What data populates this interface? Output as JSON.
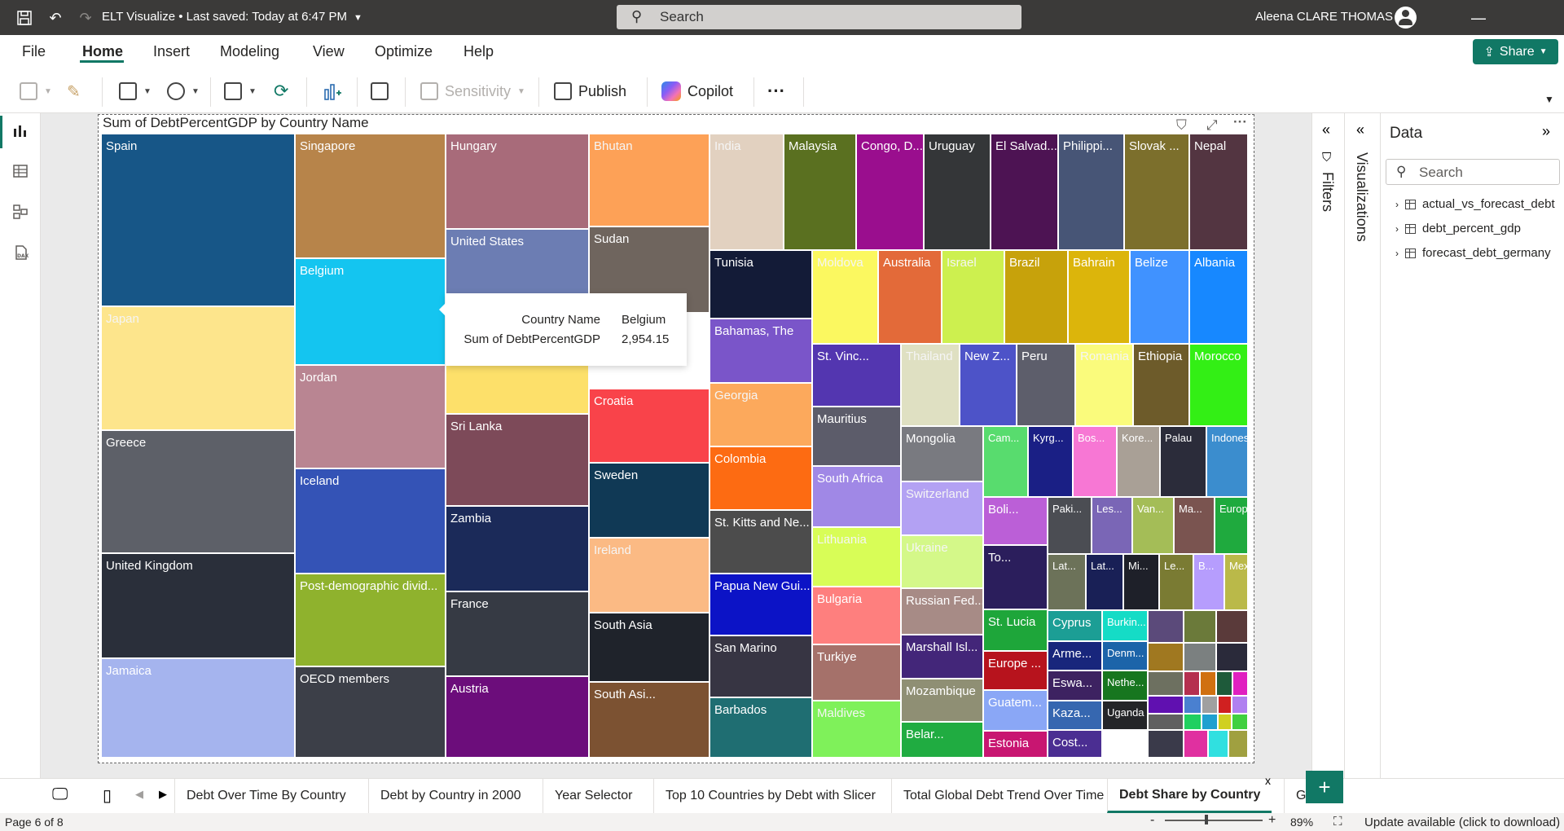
{
  "window": {
    "title": "ELT Visualize • Last saved: Today at 6:47 PM",
    "search_placeholder": "Search",
    "user_name": "Aleena CLARE THOMAS"
  },
  "menu": {
    "items": [
      "File",
      "Home",
      "Insert",
      "Modeling",
      "View",
      "Optimize",
      "Help"
    ],
    "active": "Home",
    "share_label": "Share"
  },
  "toolbar": {
    "sensitivity_label": "Sensitivity",
    "publish_label": "Publish",
    "copilot_label": "Copilot",
    "more_label": "···"
  },
  "visual": {
    "title": "Sum of DebtPercentGDP by Country Name",
    "tooltip": {
      "field_label": "Country Name",
      "field_value": "Belgium",
      "measure_label": "Sum of DebtPercentGDP",
      "measure_value": "2,954.15"
    }
  },
  "chart_data": {
    "type": "treemap",
    "title": "Sum of DebtPercentGDP by Country Name",
    "items": [
      {
        "label": "Spain",
        "color": "#175687"
      },
      {
        "label": "Japan",
        "color": "#fde58c"
      },
      {
        "label": "Greece",
        "color": "#5d6068"
      },
      {
        "label": "United Kingdom",
        "color": "#2a2f3a"
      },
      {
        "label": "Jamaica",
        "color": "#a5b4ee"
      },
      {
        "label": "Singapore",
        "color": "#b7844a"
      },
      {
        "label": "Belgium",
        "color": "#14c5f0"
      },
      {
        "label": "Jordan",
        "color": "#b98592"
      },
      {
        "label": "Iceland",
        "color": "#3453b6"
      },
      {
        "label": "Post-demographic divid...",
        "color": "#8fb22d"
      },
      {
        "label": "OECD members",
        "color": "#3c3f48"
      },
      {
        "label": "Hungary",
        "color": "#a86b7a"
      },
      {
        "label": "United States",
        "color": "#6c7db3"
      },
      {
        "label": "High income",
        "color": "#fde06a"
      },
      {
        "label": "Sri Lanka",
        "color": "#7d4a59"
      },
      {
        "label": "Zambia",
        "color": "#1b2a59"
      },
      {
        "label": "France",
        "color": "#363a44"
      },
      {
        "label": "Austria",
        "color": "#6c0d7b"
      },
      {
        "label": "Bhutan",
        "color": "#fda157"
      },
      {
        "label": "Sudan",
        "color": "#6f655e"
      },
      {
        "label": "Croatia",
        "color": "#f9434a"
      },
      {
        "label": "Sweden",
        "color": "#103955"
      },
      {
        "label": "Ireland",
        "color": "#fbba84"
      },
      {
        "label": "South Asia",
        "color": "#1f232b"
      },
      {
        "label": "South Asi...",
        "color": "#7c5232"
      },
      {
        "label": "India",
        "color": "#e2d1c0"
      },
      {
        "label": "Malaysia",
        "color": "#5a7020"
      },
      {
        "label": "Congo, D...",
        "color": "#9a0e8e"
      },
      {
        "label": "Uruguay",
        "color": "#343638"
      },
      {
        "label": "El Salvad...",
        "color": "#4d1353"
      },
      {
        "label": "Philippi...",
        "color": "#475576"
      },
      {
        "label": "Slovak ...",
        "color": "#7c6f2c"
      },
      {
        "label": "Nepal",
        "color": "#533541"
      },
      {
        "label": "Tunisia",
        "color": "#131b37"
      },
      {
        "label": "Bahamas, The",
        "color": "#7a55c9"
      },
      {
        "label": "Georgia",
        "color": "#fca95c"
      },
      {
        "label": "Colombia",
        "color": "#fd6b12"
      },
      {
        "label": "St. Kitts and Ne...",
        "color": "#4c4c4c"
      },
      {
        "label": "Papua New Gui...",
        "color": "#0c13c6"
      },
      {
        "label": "San Marino",
        "color": "#373543"
      },
      {
        "label": "Barbados",
        "color": "#1f6e72"
      },
      {
        "label": "Moldova",
        "color": "#fbf860"
      },
      {
        "label": "Australia",
        "color": "#e36a39"
      },
      {
        "label": "Israel",
        "color": "#cdf04f"
      },
      {
        "label": "Brazil",
        "color": "#c7a20b"
      },
      {
        "label": "Bahrain",
        "color": "#dcb50b"
      },
      {
        "label": "Belize",
        "color": "#4092ff"
      },
      {
        "label": "Albania",
        "color": "#1788ff"
      },
      {
        "label": "St. Vinc...",
        "color": "#5336b0"
      },
      {
        "label": "Thailand",
        "color": "#dfe0c2"
      },
      {
        "label": "New Z...",
        "color": "#4d53c8"
      },
      {
        "label": "Peru",
        "color": "#5d5e6b"
      },
      {
        "label": "Romania",
        "color": "#fafb7c"
      },
      {
        "label": "Ethiopia",
        "color": "#6d5b2a"
      },
      {
        "label": "Morocco",
        "color": "#33ef15"
      },
      {
        "label": "Mauritius",
        "color": "#5c5c6a"
      },
      {
        "label": "South Africa",
        "color": "#a088e6"
      },
      {
        "label": "Lithuania",
        "color": "#d8fd57"
      },
      {
        "label": "Bulgaria",
        "color": "#fe7f7e"
      },
      {
        "label": "Turkiye",
        "color": "#a5716a"
      },
      {
        "label": "Maldives",
        "color": "#7ff15a"
      },
      {
        "label": "Mongolia",
        "color": "#797a80"
      },
      {
        "label": "Switzerland",
        "color": "#b3a1f3"
      },
      {
        "label": "Ukraine",
        "color": "#d4f889"
      },
      {
        "label": "Russian Fed...",
        "color": "#a78b86"
      },
      {
        "label": "Marshall Isl...",
        "color": "#432679"
      },
      {
        "label": "Mozambique",
        "color": "#8f8f74"
      },
      {
        "label": "Belar...",
        "color": "#20ac41"
      },
      {
        "label": "Cam...",
        "color": "#58dc6e"
      },
      {
        "label": "Kyrg...",
        "color": "#1a1f85"
      },
      {
        "label": "Bos...",
        "color": "#f777d4"
      },
      {
        "label": "Kore...",
        "color": "#a9a096"
      },
      {
        "label": "Palau",
        "color": "#2b2c3a"
      },
      {
        "label": "Indonesia",
        "color": "#3b8dce"
      },
      {
        "label": "Boli...",
        "color": "#bb5fd7"
      },
      {
        "label": "Paki...",
        "color": "#4b4d53"
      },
      {
        "label": "Les...",
        "color": "#7a66b6"
      },
      {
        "label": "Van...",
        "color": "#a4bd57"
      },
      {
        "label": "Ma...",
        "color": "#7a5450"
      },
      {
        "label": "Europe ...",
        "color": "#1faa3e"
      },
      {
        "label": "To...",
        "color": "#2b1e5c"
      },
      {
        "label": "Lat...",
        "color": "#6c7259"
      },
      {
        "label": "Lat...",
        "color": "#192056"
      },
      {
        "label": "Mi...",
        "color": "#1e2029"
      },
      {
        "label": "Le...",
        "color": "#7a7b33"
      },
      {
        "label": "B...",
        "color": "#b69dfd"
      },
      {
        "label": "Mexico",
        "color": "#bab949"
      },
      {
        "label": "St. Lucia",
        "color": "#1ea63a"
      },
      {
        "label": "Europe ...",
        "color": "#b7131d"
      },
      {
        "label": "Guatem...",
        "color": "#8aa7f6"
      },
      {
        "label": "Estonia",
        "color": "#c81671"
      },
      {
        "label": "Cyprus",
        "color": "#1c9e95"
      },
      {
        "label": "Burkin...",
        "color": "#15dcc6"
      },
      {
        "label": "Arme...",
        "color": "#18267c"
      },
      {
        "label": "Denm...",
        "color": "#1c64a9"
      },
      {
        "label": "Eswa...",
        "color": "#3d2261"
      },
      {
        "label": "Nethe...",
        "color": "#17761f"
      },
      {
        "label": "Kaza...",
        "color": "#3667b0"
      },
      {
        "label": "Uganda",
        "color": "#242528"
      },
      {
        "label": "Cost...",
        "color": "#4b2e92"
      }
    ]
  },
  "data_pane": {
    "title": "Data",
    "search_placeholder": "Search",
    "tables": [
      "actual_vs_forecast_debt",
      "debt_percent_gdp",
      "forecast_debt_germany"
    ]
  },
  "panes": {
    "filters_label": "Filters",
    "visualizations_label": "Visualizations"
  },
  "pages": {
    "tabs": [
      "Debt Over Time By Country",
      "Debt by Country in 2000",
      "Year Selector",
      "Top 10 Countries by Debt with Slicer",
      "Total Global Debt Trend Over Time",
      "Debt Share by Country"
    ],
    "active": "Debt Share by Country",
    "overflow_tab": "G",
    "close_glyph": "x",
    "add_label": "+"
  },
  "status": {
    "page_indicator": "Page 6 of 8",
    "zoom": "89%",
    "update_text": "Update available (click to download)"
  }
}
